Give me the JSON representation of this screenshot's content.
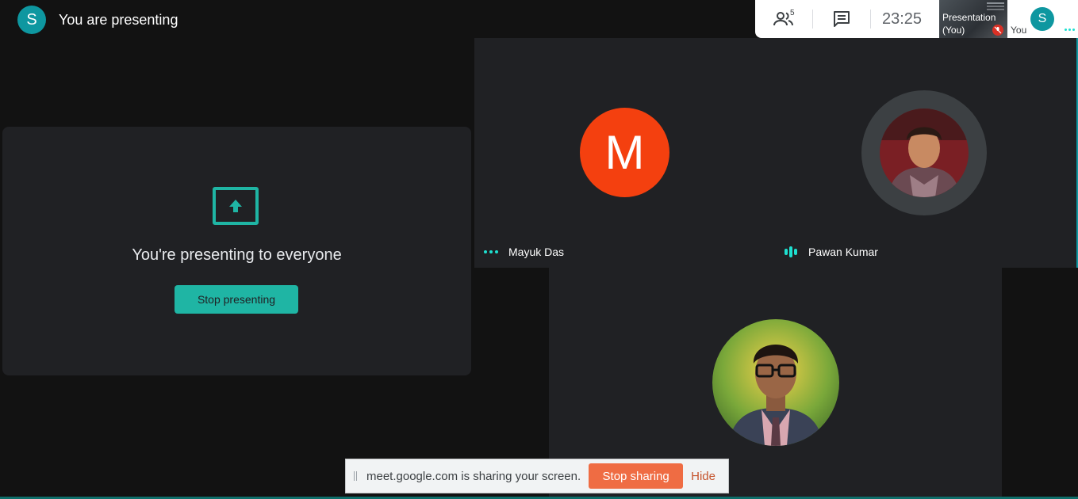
{
  "header": {
    "avatar_initial": "S",
    "title": "You are presenting"
  },
  "toolbar": {
    "people_icon": "people-icon",
    "people_count": "5",
    "chat_icon": "chat-icon",
    "clock": "23:25"
  },
  "self_tiles": {
    "presentation_label": "Presentation (You)",
    "mic_muted_icon": "mic-off-icon",
    "you_initial": "S",
    "you_label": "You",
    "more_icon": "more-dots-icon"
  },
  "presenting_card": {
    "icon": "present-screen-icon",
    "message": "You're presenting to everyone",
    "button_label": "Stop presenting"
  },
  "participants": [
    {
      "name": "Mayuk Das",
      "initial": "M",
      "avatar_color": "#f4400f",
      "indicator": "more-dots-icon"
    },
    {
      "name": "Pawan Kumar",
      "indicator": "speaking-bars-icon"
    },
    {
      "name": ""
    }
  ],
  "share_bar": {
    "message": "meet.google.com is sharing your screen.",
    "stop_label": "Stop sharing",
    "hide_label": "Hide"
  },
  "colors": {
    "accent_teal": "#1fb5a4",
    "avatar_teal": "#0e97a0",
    "stop_sharing_orange": "#ef6c43",
    "tile_bg": "#202124",
    "page_bg": "#121212"
  }
}
